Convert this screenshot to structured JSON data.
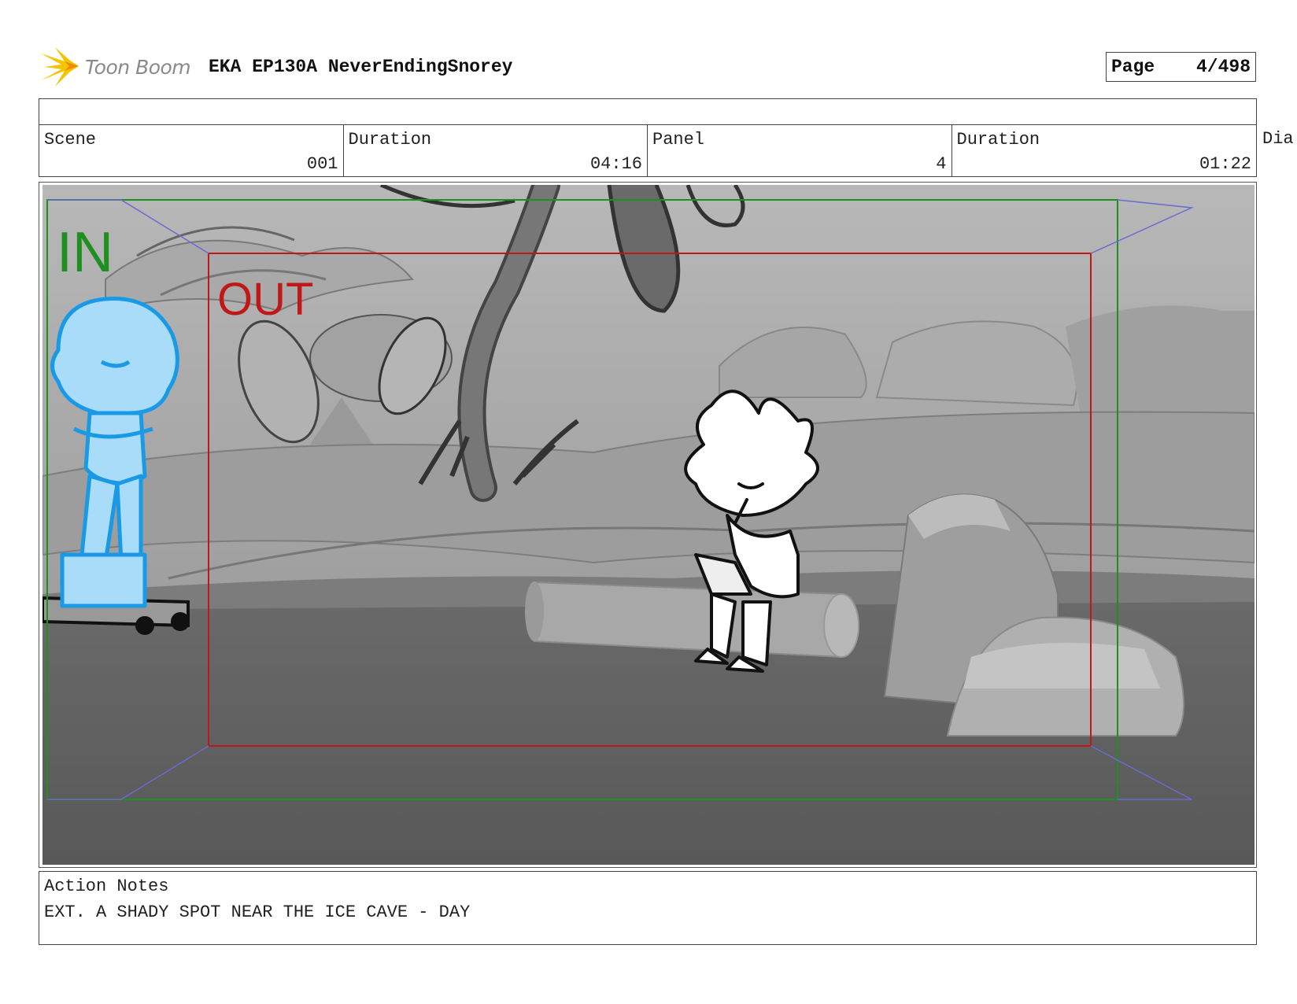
{
  "brand": {
    "logo_text": "Toon Boom",
    "logo_accent_color": "#f5c400"
  },
  "header": {
    "project_title": "EKA EP130A NeverEndingSnorey",
    "page_label": "Page",
    "page_value": "4/498"
  },
  "info": {
    "scene_label": "Scene",
    "scene_value": "001",
    "scene_duration_label": "Duration",
    "scene_duration_value": "04:16",
    "panel_label": "Panel",
    "panel_value": "4",
    "panel_duration_label": "Duration",
    "panel_duration_value": "01:22",
    "dialogue_label_partial": "Dia"
  },
  "camera": {
    "in_label": "IN",
    "out_label": "OUT",
    "in_color": "#1f8f1f",
    "out_color": "#c01818",
    "guide_color": "#6a6ad0"
  },
  "notes": {
    "label": "Action Notes",
    "text": "EXT. A SHADY SPOT NEAR THE ICE CAVE - DAY"
  }
}
